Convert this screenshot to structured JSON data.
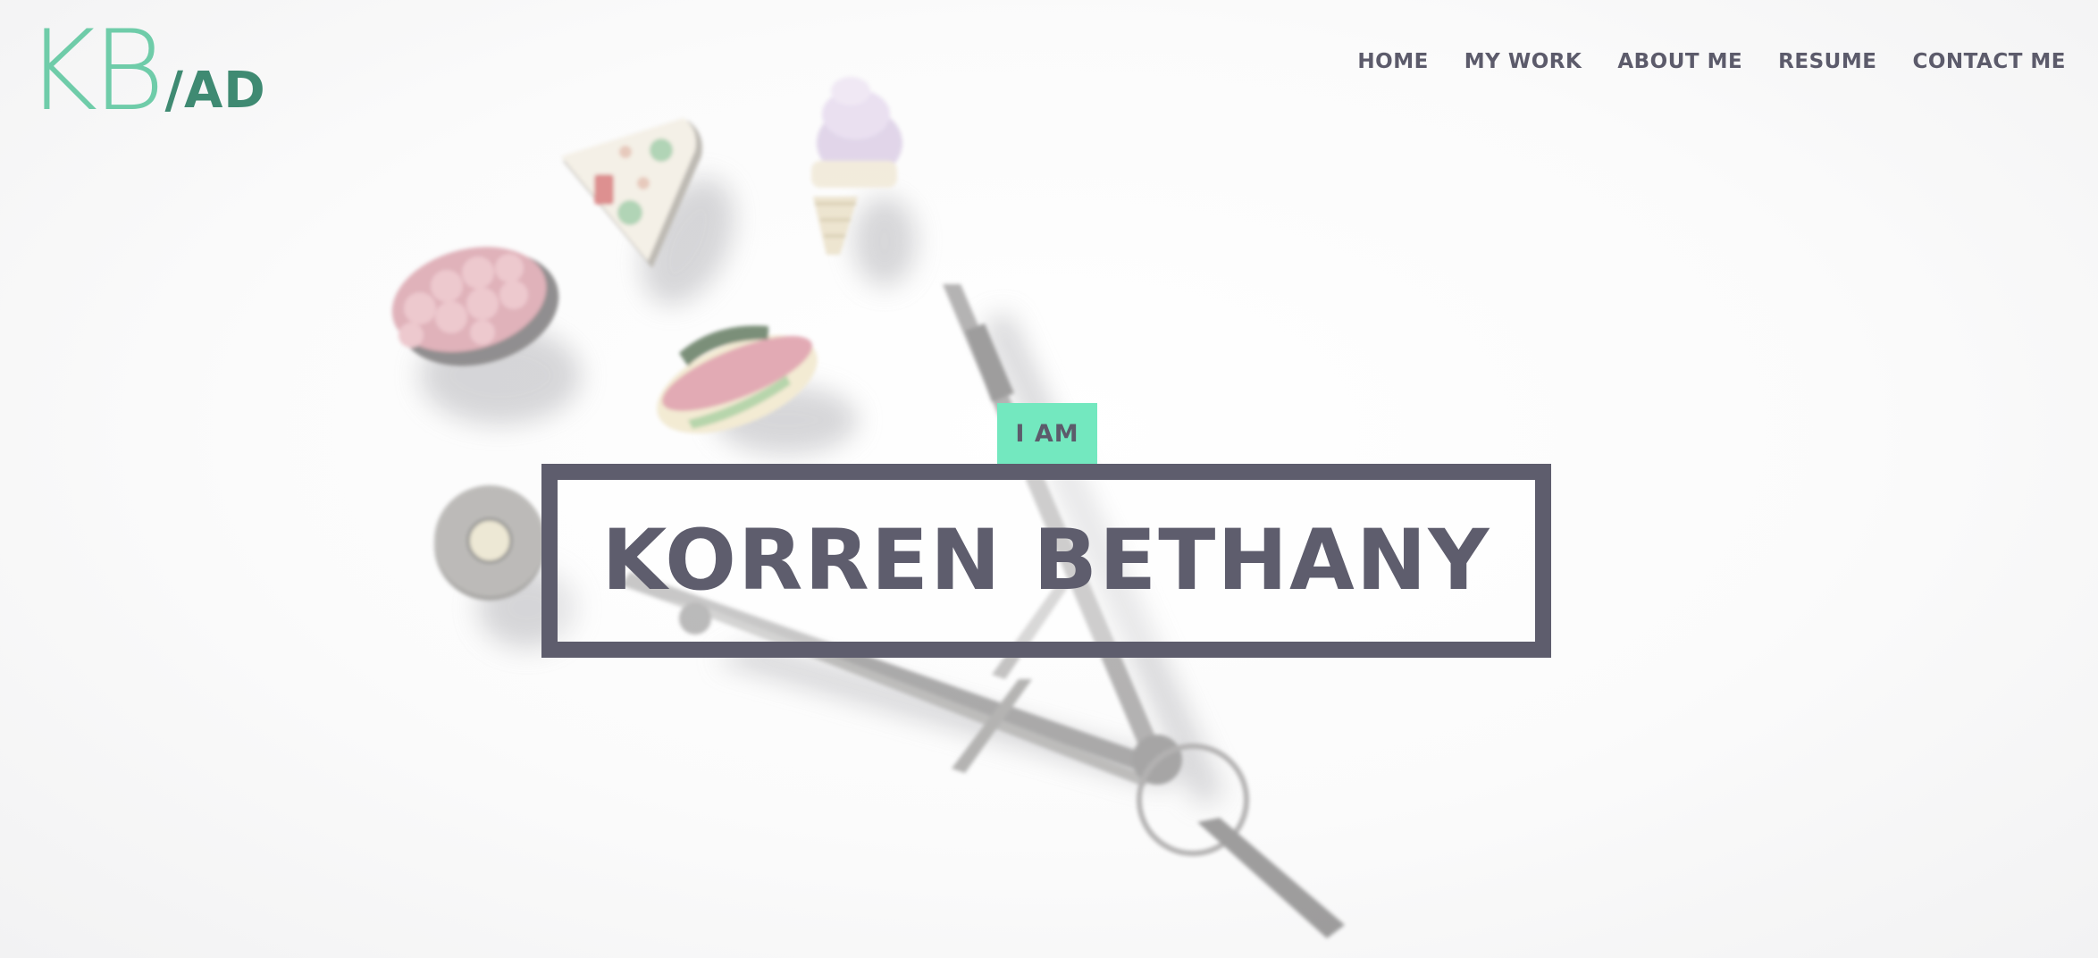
{
  "brand": {
    "logo_main": "KB",
    "logo_sub": "/AD",
    "colors": {
      "logo_main": "#6fcca9",
      "logo_sub": "#3f8a72"
    }
  },
  "nav": {
    "items": [
      {
        "label": "HOME"
      },
      {
        "label": "MY WORK"
      },
      {
        "label": "ABOUT ME"
      },
      {
        "label": "RESUME"
      },
      {
        "label": "CONTACT ME"
      }
    ],
    "color": "#5c5b6b"
  },
  "hero": {
    "tagline": "I AM",
    "name": "KORREN BETHANY",
    "colors": {
      "tag_background": "#73e8bf",
      "tag_text": "#5c5b6b",
      "box_border": "#5e5d6d",
      "name_text": "#5e5d6d"
    },
    "photo_subject": "desk-objects-photo"
  }
}
